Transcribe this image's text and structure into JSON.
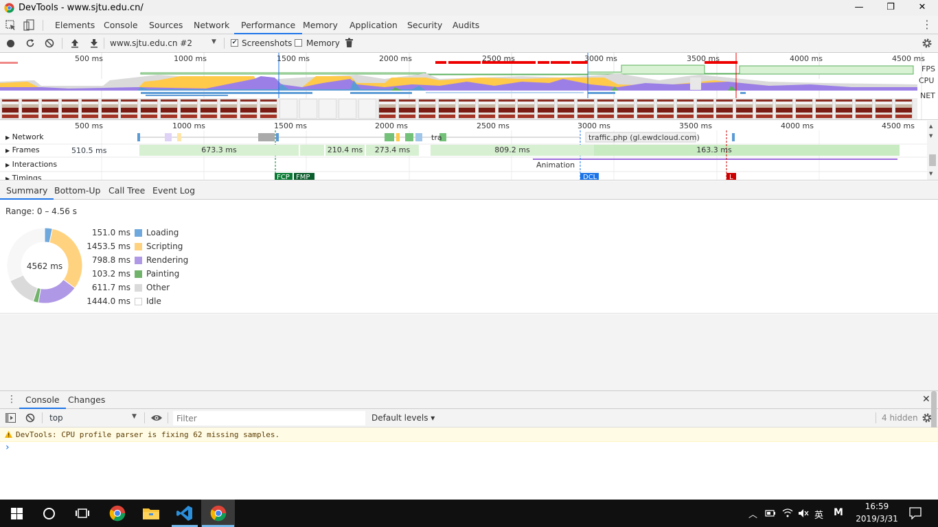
{
  "window": {
    "title": "DevTools - www.sjtu.edu.cn/",
    "minimize": "—",
    "restore": "❐",
    "close": "✕"
  },
  "devtools_tabs": [
    "Elements",
    "Console",
    "Sources",
    "Network",
    "Performance",
    "Memory",
    "Application",
    "Security",
    "Audits"
  ],
  "active_tab": "Performance",
  "perf_toolbar": {
    "profile_select": "www.sjtu.edu.cn #2",
    "screenshots_label": "Screenshots",
    "screenshots_checked": true,
    "memory_label": "Memory",
    "memory_checked": false
  },
  "overview": {
    "ticks": [
      "500 ms",
      "1000 ms",
      "1500 ms",
      "2000 ms",
      "2500 ms",
      "3000 ms",
      "3500 ms",
      "4000 ms",
      "4500 ms"
    ],
    "fps_label": "FPS",
    "cpu_label": "CPU",
    "net_label": "NET"
  },
  "flame": {
    "ticks": [
      "500 ms",
      "1000 ms",
      "1500 ms",
      "2000 ms",
      "2500 ms",
      "3000 ms",
      "3500 ms",
      "4000 ms",
      "4500 ms"
    ],
    "rows": [
      "Network",
      "Frames",
      "Interactions",
      "Timings"
    ],
    "frames_first": "510.5 ms",
    "frames": [
      "673.3 ms",
      "210.4 ms",
      "273.4 ms",
      "809.2 ms",
      "163.3 ms"
    ],
    "network_label_1": "tra",
    "network_label_2": "traffic.php (gl.ewdcloud.com)",
    "animation_label": "Animation",
    "fcp": "FCP",
    "fmp": "FMP",
    "dcl": "DCL",
    "load": "L"
  },
  "lower_tabs": [
    "Summary",
    "Bottom-Up",
    "Call Tree",
    "Event Log"
  ],
  "summary": {
    "range": "Range: 0 – 4.56 s",
    "total": "4562 ms",
    "rows": [
      {
        "value": "151.0 ms",
        "label": "Loading",
        "color": "#6fa8dc",
        "ms": 151.0
      },
      {
        "value": "1453.5 ms",
        "label": "Scripting",
        "color": "#ffd27f",
        "ms": 1453.5
      },
      {
        "value": "798.8 ms",
        "label": "Rendering",
        "color": "#af98e5",
        "ms": 798.8
      },
      {
        "value": "103.2 ms",
        "label": "Painting",
        "color": "#71b36b",
        "ms": 103.2
      },
      {
        "value": "611.7 ms",
        "label": "Other",
        "color": "#dadada",
        "ms": 611.7
      },
      {
        "value": "1444.0 ms",
        "label": "Idle",
        "color": "#ffffff",
        "ms": 1444.0
      }
    ]
  },
  "drawer": {
    "tabs": [
      "Console",
      "Changes"
    ],
    "context": "top",
    "filter_placeholder": "Filter",
    "levels": "Default levels ▾",
    "hidden": "4 hidden",
    "warning": "DevTools: CPU profile parser is fixing 62 missing samples.",
    "prompt": "›"
  },
  "taskbar": {
    "time": "16:59",
    "date": "2019/3/31",
    "ime": "英",
    "ime2": "M"
  }
}
